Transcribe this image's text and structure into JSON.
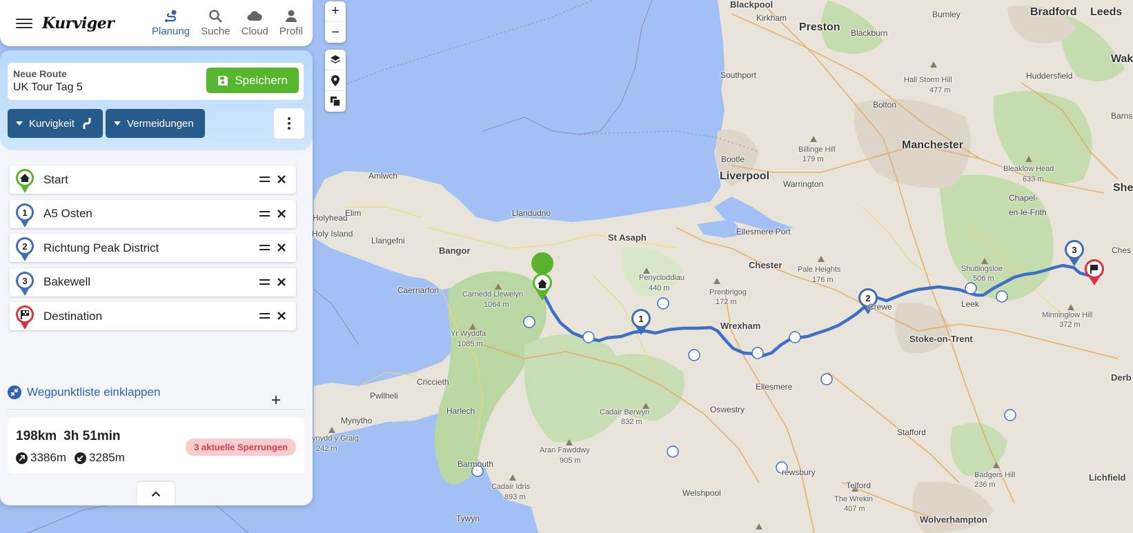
{
  "app": {
    "logo": "Kurviger"
  },
  "nav": [
    {
      "label": "Planung",
      "icon": "route-planning-icon",
      "active": true
    },
    {
      "label": "Suche",
      "icon": "search-icon",
      "active": false
    },
    {
      "label": "Cloud",
      "icon": "cloud-icon",
      "active": false
    },
    {
      "label": "Profil",
      "icon": "profile-icon",
      "active": false
    }
  ],
  "route": {
    "label": "Neue Route",
    "name": "UK Tour Tag 5",
    "save_label": "Speichern"
  },
  "options": {
    "curviness_label": "Kurvigkeit",
    "avoid_label": "Vermeidungen"
  },
  "waypoints": [
    {
      "label": "Start",
      "marker": "home-icon",
      "color": "#5cb22e"
    },
    {
      "label": "A5 Osten",
      "marker": "1",
      "color": "#3f6db5"
    },
    {
      "label": "Richtung Peak District",
      "marker": "2",
      "color": "#3f6db5"
    },
    {
      "label": "Bakewell",
      "marker": "3",
      "color": "#3f6db5"
    },
    {
      "label": "Destination",
      "marker": "finish-flag-icon",
      "color": "#d7333d"
    }
  ],
  "collapse_label": "Wegpunktliste einklappen",
  "summary": {
    "distance": "198km",
    "duration": "3h 51min",
    "ascent": "3386m",
    "descent": "3285m",
    "closures": "3 aktuelle Sperrungen"
  },
  "map": {
    "zoom_in": "+",
    "zoom_out": "−",
    "route_color": "#3d6fc7",
    "places": [
      {
        "text": "Blackpool",
        "cls": "town"
      },
      {
        "text": "Kirkham",
        "cls": "village"
      },
      {
        "text": "Preston",
        "cls": "city"
      },
      {
        "text": "Blackburn",
        "cls": "village"
      },
      {
        "text": "Burnley",
        "cls": "village"
      },
      {
        "text": "Bradford",
        "cls": "city"
      },
      {
        "text": "Leeds",
        "cls": "city"
      },
      {
        "text": "Wakefi",
        "cls": "city"
      },
      {
        "text": "Southport",
        "cls": "village"
      },
      {
        "text": "Hall Storm Hill",
        "cls": "peak"
      },
      {
        "text": "477 m",
        "cls": "peak"
      },
      {
        "text": "Huddersfield",
        "cls": "village"
      },
      {
        "text": "Bolton",
        "cls": "village"
      },
      {
        "text": "Barnsl",
        "cls": "village"
      },
      {
        "text": "Manchester",
        "cls": "city"
      },
      {
        "text": "Billinge Hill",
        "cls": "peak"
      },
      {
        "text": "179 m",
        "cls": "peak"
      },
      {
        "text": "Bootle",
        "cls": "village"
      },
      {
        "text": "Liverpool",
        "cls": "city"
      },
      {
        "text": "Warrington",
        "cls": "village"
      },
      {
        "text": "Bleaklow Head",
        "cls": "peak"
      },
      {
        "text": "633 m",
        "cls": "peak"
      },
      {
        "text": "Sheffi",
        "cls": "city"
      },
      {
        "text": "Amlwch",
        "cls": "village"
      },
      {
        "text": "Holyhead",
        "cls": "village"
      },
      {
        "text": "Elim",
        "cls": "village"
      },
      {
        "text": "Holy Island",
        "cls": "village"
      },
      {
        "text": "Llandudno",
        "cls": "village"
      },
      {
        "text": "Llangefni",
        "cls": "village"
      },
      {
        "text": "Chapel-",
        "cls": "village"
      },
      {
        "text": "en-le-Frith",
        "cls": "village"
      },
      {
        "text": "Ellesmere Port",
        "cls": "village"
      },
      {
        "text": "St Asaph",
        "cls": "town"
      },
      {
        "text": "Bangor",
        "cls": "town"
      },
      {
        "text": "Ches",
        "cls": "village"
      },
      {
        "text": "Chester",
        "cls": "town"
      },
      {
        "text": "Pale Heights",
        "cls": "peak"
      },
      {
        "text": "176 m",
        "cls": "peak"
      },
      {
        "text": "Penycloddiau",
        "cls": "peak"
      },
      {
        "text": "440 m",
        "cls": "peak"
      },
      {
        "text": "Shutlingsloe",
        "cls": "peak"
      },
      {
        "text": "506 m",
        "cls": "peak"
      },
      {
        "text": "Caernarfon",
        "cls": "village"
      },
      {
        "text": "Carnedd Llewelyn",
        "cls": "peak"
      },
      {
        "text": "1064 m",
        "cls": "peak"
      },
      {
        "text": "Prenbrigog",
        "cls": "peak"
      },
      {
        "text": "172 m",
        "cls": "peak"
      },
      {
        "text": "Crewe",
        "cls": "village"
      },
      {
        "text": "Leek",
        "cls": "village"
      },
      {
        "text": "Minninglow Hill",
        "cls": "peak"
      },
      {
        "text": "372 m",
        "cls": "peak"
      },
      {
        "text": "Wrexham",
        "cls": "town"
      },
      {
        "text": "Yr Wyddfa",
        "cls": "peak"
      },
      {
        "text": "1085 m",
        "cls": "peak"
      },
      {
        "text": "Stoke-on-Trent",
        "cls": "town"
      },
      {
        "text": "Derb",
        "cls": "town"
      },
      {
        "text": "Criccieth",
        "cls": "village"
      },
      {
        "text": "Pwllheli",
        "cls": "village"
      },
      {
        "text": "Ellesmere",
        "cls": "village"
      },
      {
        "text": "Harlech",
        "cls": "village"
      },
      {
        "text": "Oswestry",
        "cls": "village"
      },
      {
        "text": "Cadair Berwyn",
        "cls": "peak"
      },
      {
        "text": "832 m",
        "cls": "peak"
      },
      {
        "text": "Mynytho",
        "cls": "village"
      },
      {
        "text": "Stafford",
        "cls": "village"
      },
      {
        "text": "ynydd y Graig",
        "cls": "peak"
      },
      {
        "text": "242 m",
        "cls": "peak"
      },
      {
        "text": "Aran Fawddwy",
        "cls": "peak"
      },
      {
        "text": "905 m",
        "cls": "peak"
      },
      {
        "text": "rewsbury",
        "cls": "village"
      },
      {
        "text": "Barmouth",
        "cls": "village"
      },
      {
        "text": "Badgers Hill",
        "cls": "peak"
      },
      {
        "text": "236 m",
        "cls": "peak"
      },
      {
        "text": "Lichfield",
        "cls": "town"
      },
      {
        "text": "Telford",
        "cls": "village"
      },
      {
        "text": "Welshpool",
        "cls": "village"
      },
      {
        "text": "Cadair Idris",
        "cls": "peak"
      },
      {
        "text": "893 m",
        "cls": "peak"
      },
      {
        "text": "The Wrekin",
        "cls": "peak"
      },
      {
        "text": "407 m",
        "cls": "peak"
      },
      {
        "text": "Tywyn",
        "cls": "village"
      },
      {
        "text": "Wolverhampton",
        "cls": "town"
      }
    ]
  }
}
